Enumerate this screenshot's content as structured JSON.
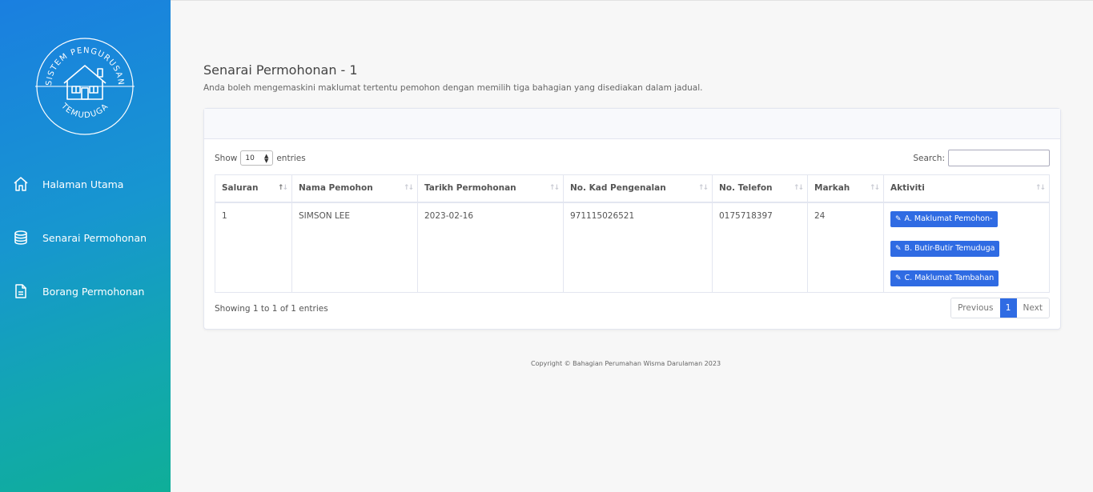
{
  "sidebar": {
    "logo": {
      "top_text": "SISTEM PENGURUSAN",
      "bottom_text": "TEMUDUGA"
    },
    "items": [
      {
        "label": "Halaman Utama",
        "icon": "home-icon"
      },
      {
        "label": "Senarai Permohonan",
        "icon": "database-icon"
      },
      {
        "label": "Borang Permohonan",
        "icon": "file-icon"
      }
    ]
  },
  "page": {
    "title": "Senarai Permohonan - 1",
    "subtitle": "Anda boleh mengemaskini maklumat tertentu pemohon dengan memilih tiga bahagian yang disediakan dalam jadual."
  },
  "table_controls": {
    "show_label": "Show",
    "show_value": "10",
    "entries_label": "entries",
    "search_label": "Search:",
    "search_value": ""
  },
  "table": {
    "columns": [
      "Saluran",
      "Nama Pemohon",
      "Tarikh Permohonan",
      "No. Kad Pengenalan",
      "No. Telefon",
      "Markah",
      "Aktiviti"
    ],
    "rows": [
      {
        "saluran": "1",
        "nama": "SIMSON LEE",
        "tarikh": "2023-02-16",
        "kad": "971115026521",
        "telefon": "0175718397",
        "markah": "24",
        "actions": [
          "A. Maklumat Pemohon-",
          "B. Butir-Butir Temuduga",
          "C. Maklumat Tambahan"
        ]
      }
    ]
  },
  "pagination": {
    "info": "Showing 1 to 1 of 1 entries",
    "previous": "Previous",
    "current": "1",
    "next": "Next"
  },
  "footer": {
    "copyright": "Copyright © Bahagian Perumahan Wisma Darulaman 2023"
  },
  "colors": {
    "primary": "#2f6be3",
    "sidebar_top": "#1a7fe0",
    "sidebar_bottom": "#0fae98"
  }
}
